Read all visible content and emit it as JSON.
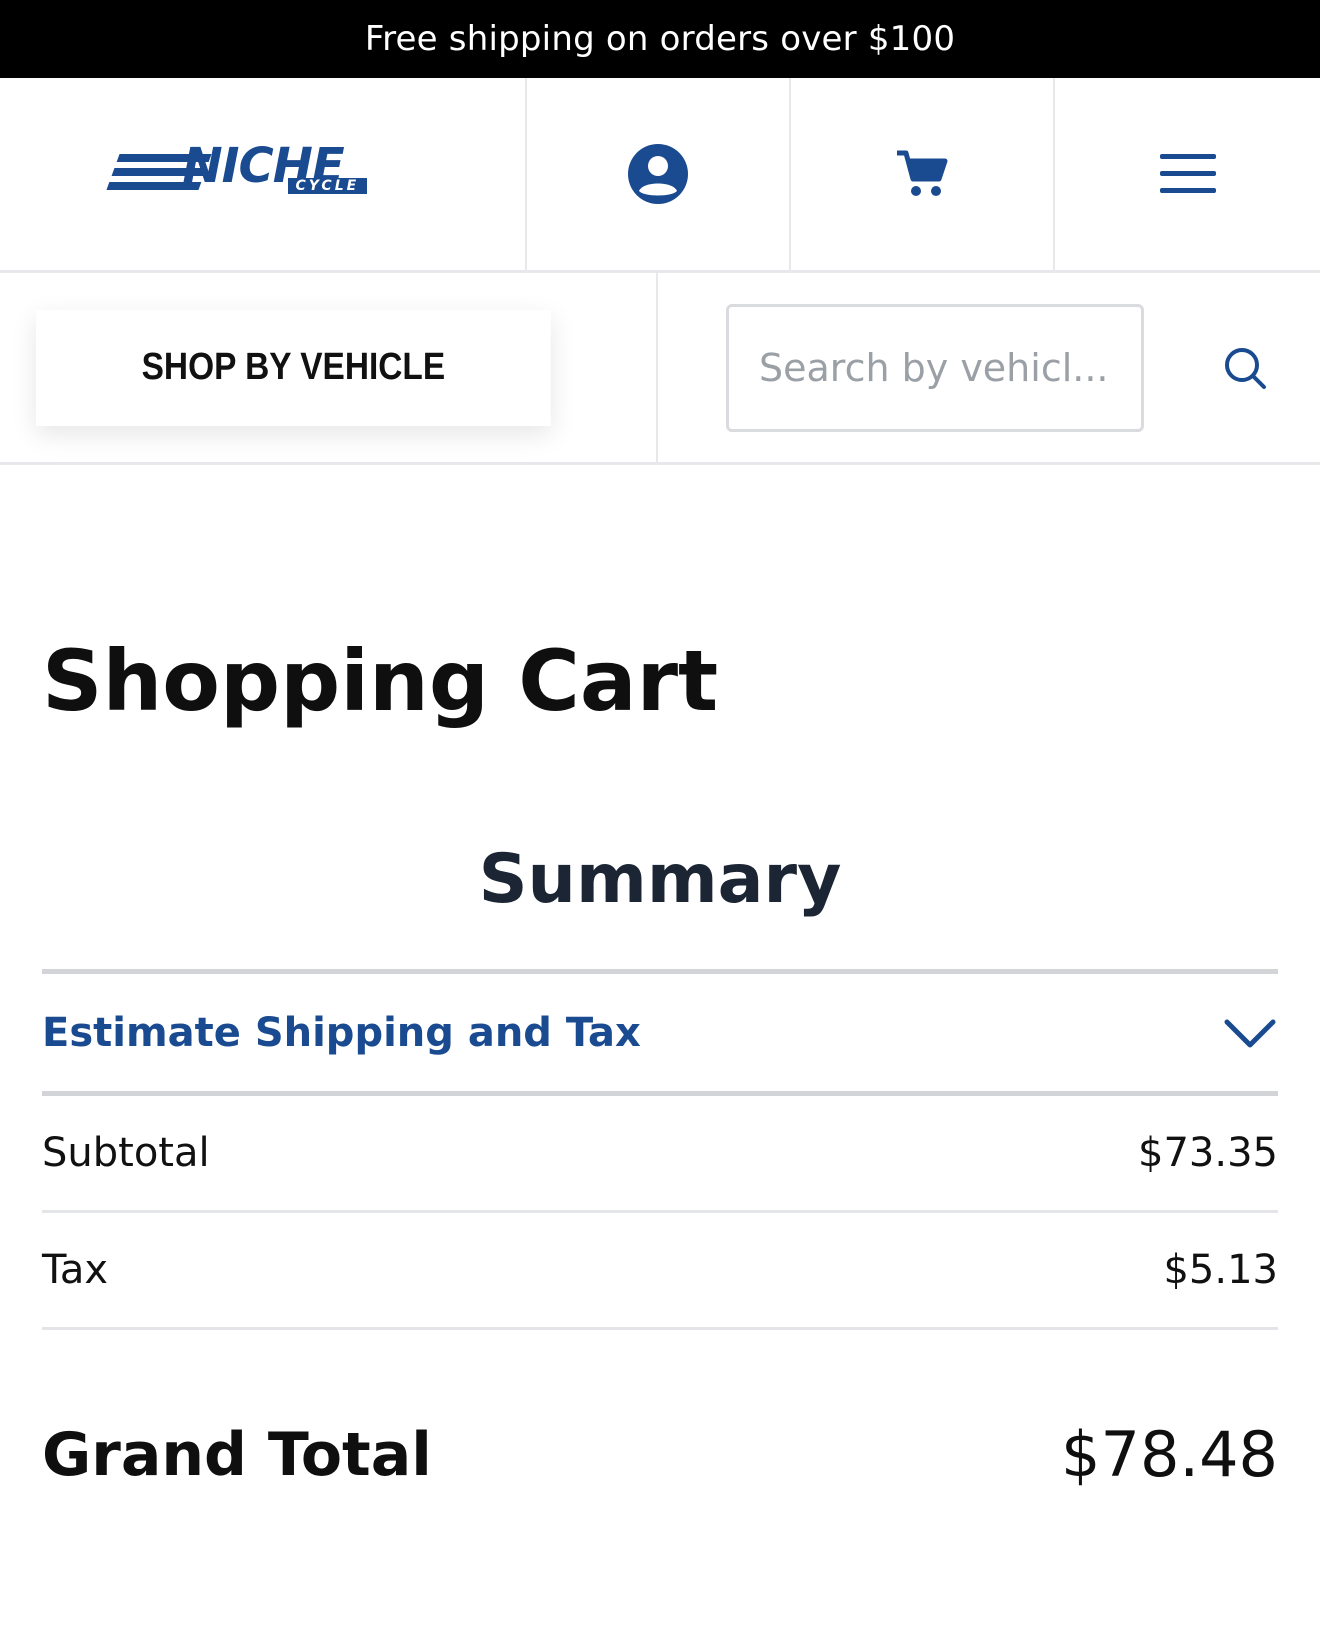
{
  "promo": {
    "text": "Free shipping on orders over $100"
  },
  "header": {
    "logo": {
      "word": "NICHE",
      "sub": "CYCLE"
    },
    "icons": {
      "account": "account-circle-icon",
      "cart": "cart-icon",
      "menu": "hamburger-menu-icon"
    }
  },
  "subbar": {
    "shop_by_vehicle": "SHOP BY VEHICLE",
    "search_placeholder": "Search by vehicl...",
    "search_icon": "search-icon"
  },
  "page": {
    "title": "Shopping Cart",
    "summary_heading": "Summary",
    "estimate_label": "Estimate Shipping and Tax",
    "rows": [
      {
        "label": "Subtotal",
        "value": "$73.35"
      },
      {
        "label": "Tax",
        "value": "$5.13"
      }
    ],
    "grand_total": {
      "label": "Grand Total",
      "value": "$78.48"
    }
  },
  "colors": {
    "brand": "#1a4a8f",
    "promo_bg": "#000000",
    "divider": "#e3e5e8"
  }
}
